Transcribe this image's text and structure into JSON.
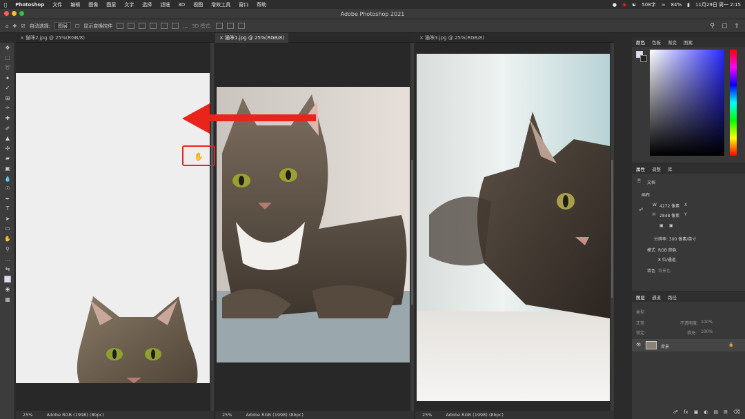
{
  "menubar": {
    "app_name": "Photoshop",
    "items": [
      "文件",
      "编辑",
      "图像",
      "图层",
      "文字",
      "选择",
      "滤镜",
      "3D",
      "视图",
      "增效工具",
      "窗口",
      "帮助"
    ],
    "word_count": "508字",
    "battery": "84%",
    "datetime": "11月29日 周一 2:15"
  },
  "window": {
    "title": "Adobe Photoshop 2021"
  },
  "options_bar": {
    "auto_select_label": "自动选择:",
    "auto_select_value": "图层",
    "show_transform_label": "显示变换控件",
    "mode_3d_label": "3D 模式:"
  },
  "documents": [
    {
      "tab": "猫咪2.jpg @ 25%(RGB/8)",
      "zoom": "25%",
      "profile": "Adobe RGB (1998) (8bpc)"
    },
    {
      "tab": "猫咪1.jpg @ 25%(RGB/8)",
      "zoom": "25%",
      "profile": "Adobe RGB (1998) (8bpc)"
    },
    {
      "tab": "猫咪3.jpg @ 25%(RGB/8)",
      "zoom": "25%",
      "profile": "Adobe RGB (1998) (8bpc)"
    }
  ],
  "color_panel": {
    "tabs": [
      "颜色",
      "色板",
      "渐变",
      "图案"
    ]
  },
  "properties_panel": {
    "tabs": [
      "属性",
      "调整",
      "库"
    ],
    "doc_label": "文档",
    "canvas_label": "画布",
    "w_label": "W",
    "w_value": "4272 像素",
    "h_label": "H",
    "h_value": "2848 像素",
    "x_label": "X",
    "y_label": "Y",
    "resolution": "分辨率: 300 像素/英寸",
    "mode_label": "模式",
    "mode_value": "RGB 颜色",
    "depth_value": "8 位/通道",
    "fill_label": "填色",
    "fill_value": "背景色"
  },
  "layers_panel": {
    "tabs": [
      "图层",
      "通道",
      "路径"
    ],
    "search_placeholder": "类型",
    "blend_mode": "正常",
    "opacity_label": "不透明度:",
    "opacity_value": "100%",
    "lock_label": "锁定:",
    "fill_label": "填充:",
    "fill_value": "100%",
    "layer_name": "背景"
  },
  "colors": {
    "accent_red": "#e8241c",
    "selection_box": "#e8241c",
    "menubar_bg": "#2d2d2d",
    "panel_bg": "#383838"
  }
}
